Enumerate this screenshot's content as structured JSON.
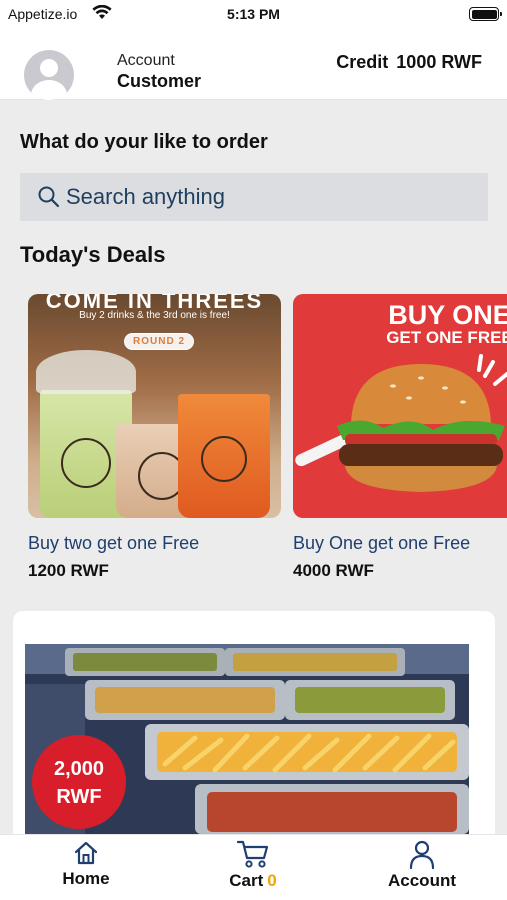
{
  "status_bar": {
    "carrier": "Appetize.io",
    "time": "5:13 PM",
    "wifi_icon": "wifi-icon",
    "battery_icon": "battery-full-icon"
  },
  "header": {
    "account_label": "Account",
    "account_name": "Customer",
    "credit_label": "Credit",
    "credit_value": "1000 RWF",
    "avatar_icon": "user-avatar-icon"
  },
  "main": {
    "prompt": "What do your like to order",
    "search": {
      "placeholder": "Search anything",
      "icon": "search-icon"
    },
    "deals_title": "Today's Deals",
    "deals": [
      {
        "image_heading": "COME IN THREES",
        "image_subtext": "Buy 2 drinks & the 3rd one is free!",
        "image_tag": "ROUND 2",
        "name": "Buy two get one Free",
        "price": "1200 RWF"
      },
      {
        "image_heading": "BUY ONE",
        "image_subtext": "GET ONE FREE",
        "name": "Buy One get one Free",
        "price": "4000 RWF"
      }
    ],
    "featured": {
      "badge_amount": "2,000",
      "badge_currency": "RWF"
    }
  },
  "bottom_nav": {
    "home": {
      "label": "Home",
      "icon": "home-icon"
    },
    "cart": {
      "label": "Cart",
      "count": "0",
      "icon": "cart-icon"
    },
    "account": {
      "label": "Account",
      "icon": "person-icon"
    }
  },
  "colors": {
    "accent_blue": "#1f3f70",
    "cart_count": "#f0a500",
    "badge_red": "#d81e2a",
    "background": "#ececec"
  }
}
